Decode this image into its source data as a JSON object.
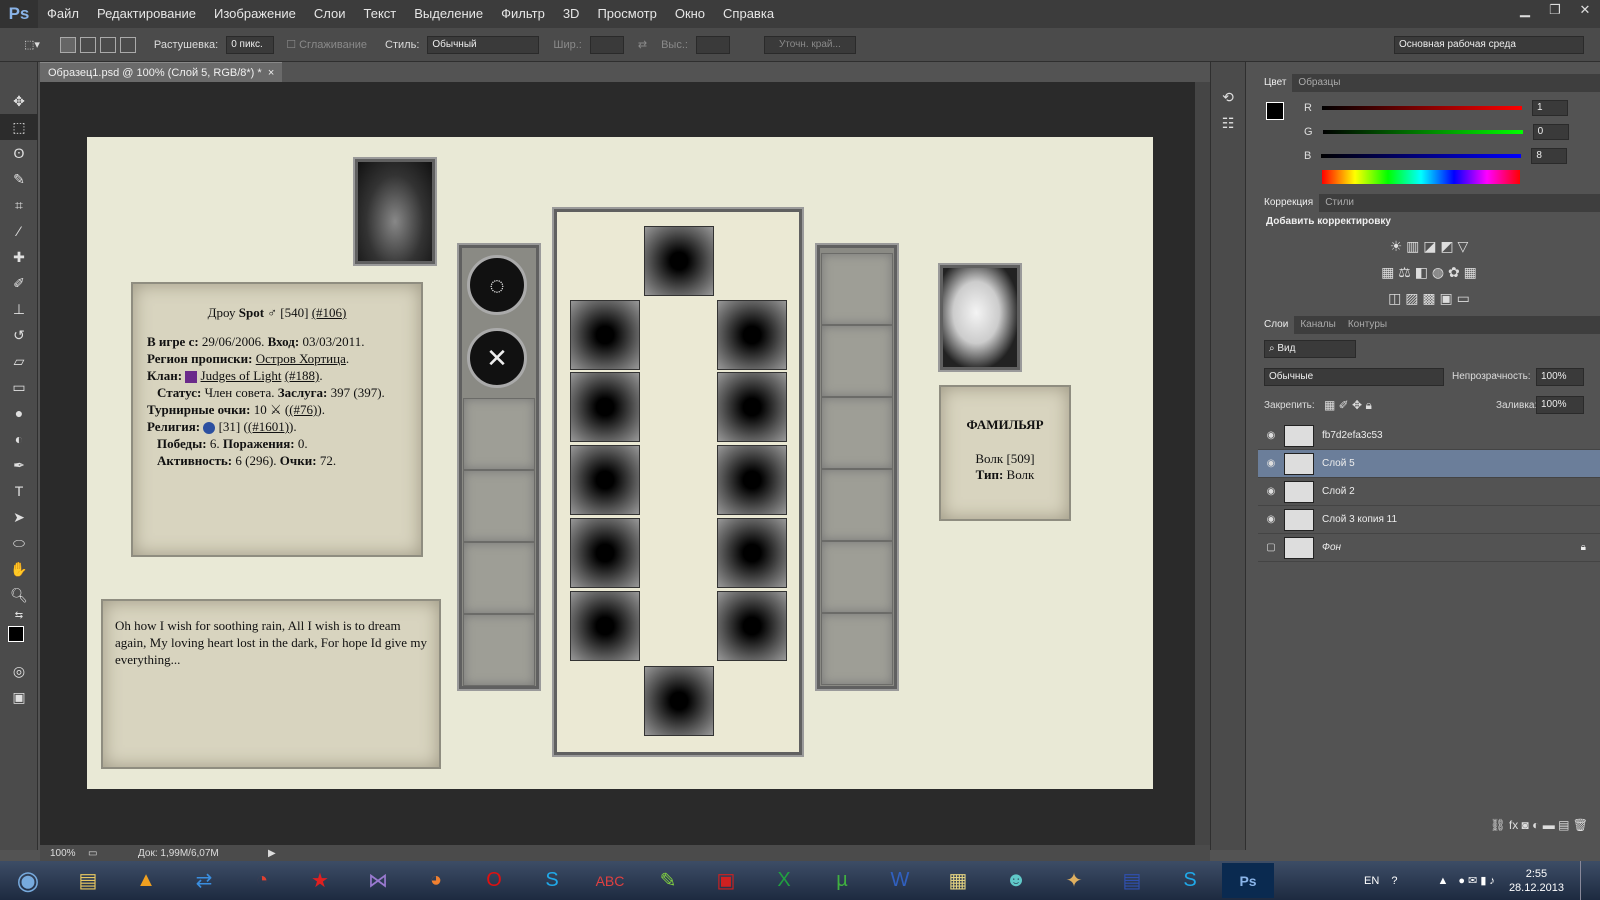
{
  "app": {
    "logo": "Ps"
  },
  "menu": [
    "Файл",
    "Редактирование",
    "Изображение",
    "Слои",
    "Текст",
    "Выделение",
    "Фильтр",
    "3D",
    "Просмотр",
    "Окно",
    "Справка"
  ],
  "options": {
    "feather_label": "Растушевка:",
    "feather_value": "0 пикс.",
    "antialias_label": "Сглаживание",
    "style_label": "Стиль:",
    "style_value": "Обычный",
    "width_label": "Шир.:",
    "height_label": "Выс.:",
    "refine_button": "Уточн. край...",
    "workspace": "Основная рабочая среда"
  },
  "document": {
    "tab_title": "Образец1.psd @ 100% (Слой 5, RGB/8*) *",
    "zoom": "100%",
    "doc_size": "Док: 1,99M/6,07M"
  },
  "canvas": {
    "profile_title_prefix": "Дроу",
    "profile_name": "Spot",
    "profile_gender": "♂",
    "profile_score": "[540]",
    "profile_rank": "(#106)",
    "line1_label": "В игре с:",
    "line1_val": "29/06/2006.",
    "line1_label2": "Вход:",
    "line1_val2": "03/03/2011.",
    "line2_label": "Регион прописки:",
    "line2_val": "Остров Хортица",
    "line3_label": "Клан:",
    "line3_val": "Judges of Light",
    "line3_rank": "(#188)",
    "line4_label": "Статус:",
    "line4_val": "Член совета.",
    "line4_label2": "Заслуга:",
    "line4_val2": "397 (397).",
    "line5_label": "Турнирные очки:",
    "line5_val": "10",
    "line5_rank": "(#76)",
    "line6_label": "Религия:",
    "line6_val": "[31]",
    "line6_rank": "(#1601)",
    "line7_label": "Победы:",
    "line7_val": "6.",
    "line7_label2": "Поражения:",
    "line7_val2": "0.",
    "line8_label": "Активность:",
    "line8_val": "6 (296).",
    "line8_label2": "Очки:",
    "line8_val2": "72.",
    "quote": "Oh how I wish for soothing rain, All I wish is to dream again, My loving heart lost in the dark, For hope Id give my everything...",
    "familiar_title": "ФАМИЛЬЯР",
    "familiar_name": "Волк [509]",
    "familiar_type_label": "Тип:",
    "familiar_type": "Волк"
  },
  "panels": {
    "color_tabs": [
      "Цвет",
      "Образцы"
    ],
    "r_label": "R",
    "r_value": "1",
    "g_label": "G",
    "g_value": "0",
    "b_label": "B",
    "b_value": "8",
    "adj_tabs": [
      "Коррекция",
      "Стили"
    ],
    "adj_title": "Добавить корректировку",
    "layers_tabs": [
      "Слои",
      "Каналы",
      "Контуры"
    ],
    "filter_kind": "Вид",
    "blend_mode": "Обычные",
    "opacity_label": "Непрозрачность:",
    "opacity_value": "100%",
    "lock_label": "Закрепить:",
    "fill_label": "Заливка:",
    "fill_value": "100%",
    "layers": [
      {
        "name": "fb7d2efa3c53",
        "visible": true
      },
      {
        "name": "Слой 5",
        "visible": true
      },
      {
        "name": "Слой 2",
        "visible": true
      },
      {
        "name": "Слой 3 копия 11",
        "visible": true
      },
      {
        "name": "Фон",
        "visible": false
      }
    ]
  },
  "taskbar": {
    "lang": "EN",
    "time": "2:55",
    "date": "28.12.2013"
  }
}
